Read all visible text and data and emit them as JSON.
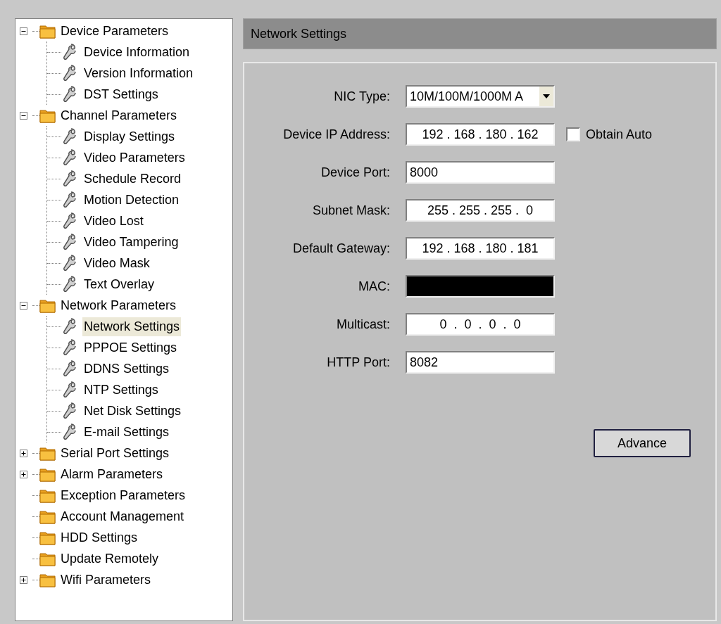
{
  "tree": [
    {
      "label": "Device Parameters",
      "kind": "group",
      "expanded": true,
      "children": [
        {
          "label": "Device Information",
          "kind": "setting",
          "selected": false
        },
        {
          "label": "Version Information",
          "kind": "setting",
          "selected": false
        },
        {
          "label": "DST Settings",
          "kind": "setting",
          "selected": false
        }
      ]
    },
    {
      "label": "Channel Parameters",
      "kind": "group",
      "expanded": true,
      "children": [
        {
          "label": "Display Settings",
          "kind": "setting",
          "selected": false
        },
        {
          "label": "Video Parameters",
          "kind": "setting",
          "selected": false
        },
        {
          "label": "Schedule Record",
          "kind": "setting",
          "selected": false
        },
        {
          "label": "Motion Detection",
          "kind": "setting",
          "selected": false
        },
        {
          "label": "Video Lost",
          "kind": "setting",
          "selected": false
        },
        {
          "label": "Video Tampering",
          "kind": "setting",
          "selected": false
        },
        {
          "label": "Video Mask",
          "kind": "setting",
          "selected": false
        },
        {
          "label": "Text Overlay",
          "kind": "setting",
          "selected": false
        }
      ]
    },
    {
      "label": "Network Parameters",
      "kind": "group",
      "expanded": true,
      "children": [
        {
          "label": "Network Settings",
          "kind": "setting",
          "selected": true
        },
        {
          "label": "PPPOE Settings",
          "kind": "setting",
          "selected": false
        },
        {
          "label": "DDNS Settings",
          "kind": "setting",
          "selected": false
        },
        {
          "label": "NTP Settings",
          "kind": "setting",
          "selected": false
        },
        {
          "label": "Net Disk Settings",
          "kind": "setting",
          "selected": false
        },
        {
          "label": "E-mail Settings",
          "kind": "setting",
          "selected": false
        }
      ]
    },
    {
      "label": "Serial Port Settings",
      "kind": "group",
      "expanded": false
    },
    {
      "label": "Alarm Parameters",
      "kind": "group",
      "expanded": false
    },
    {
      "label": "Exception Parameters",
      "kind": "folder"
    },
    {
      "label": "Account Management",
      "kind": "folder"
    },
    {
      "label": "HDD Settings",
      "kind": "folder"
    },
    {
      "label": "Update Remotely",
      "kind": "folder"
    },
    {
      "label": "Wifi Parameters",
      "kind": "group",
      "expanded": false
    }
  ],
  "panel_title": "Network Settings",
  "fields": [
    {
      "label": "NIC Type:",
      "kind": "select",
      "value": "10M/100M/1000M A"
    },
    {
      "label": "Device IP Address:",
      "kind": "ip",
      "value": "192 . 168 . 180 . 162",
      "checkbox": {
        "label": "Obtain Auto",
        "checked": false
      }
    },
    {
      "label": "Device Port:",
      "kind": "text",
      "value": "8000"
    },
    {
      "label": "Subnet Mask:",
      "kind": "ip",
      "value": "255 . 255 . 255 .  0"
    },
    {
      "label": "Default Gateway:",
      "kind": "ip",
      "value": "192 . 168 . 180 . 181"
    },
    {
      "label": "MAC:",
      "kind": "redacted"
    },
    {
      "label": "Multicast:",
      "kind": "ip",
      "value": "0  .  0  .  0  .  0"
    },
    {
      "label": "HTTP Port:",
      "kind": "text",
      "value": "8082"
    }
  ],
  "advance_button": "Advance"
}
